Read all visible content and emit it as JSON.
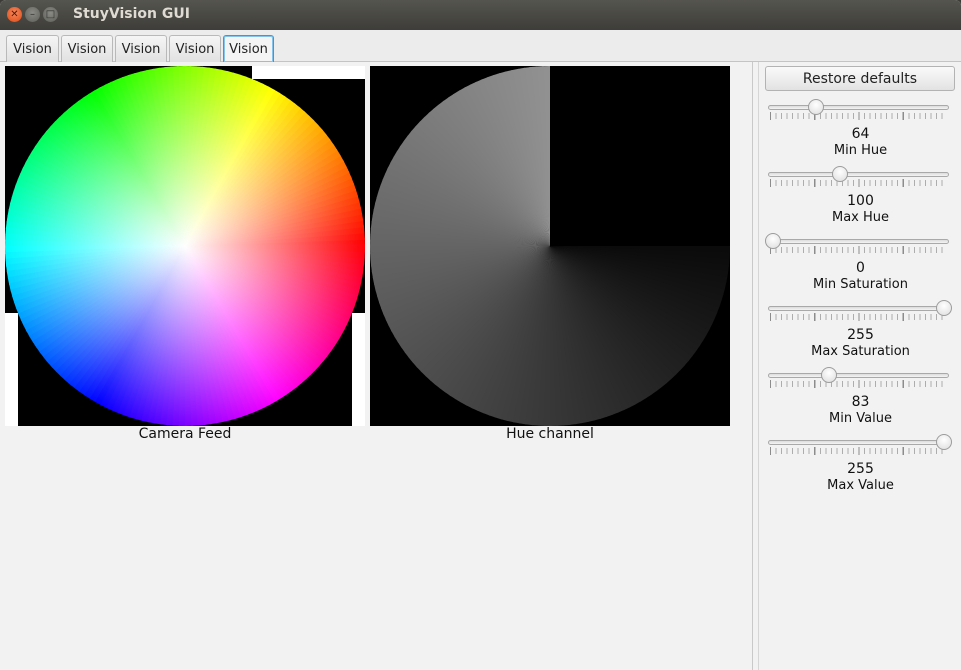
{
  "window": {
    "title": "StuyVision GUI"
  },
  "tabs": [
    {
      "label": "Vision",
      "active": false
    },
    {
      "label": "Vision",
      "active": false
    },
    {
      "label": "Vision",
      "active": false
    },
    {
      "label": "Vision",
      "active": false
    },
    {
      "label": "Vision",
      "active": true
    }
  ],
  "images": {
    "camera_caption": "Camera Feed",
    "hue_caption": "Hue channel"
  },
  "panel": {
    "restore_label": "Restore defaults",
    "sliders": [
      {
        "value": "64",
        "label": "Min Hue",
        "fraction": 0.25
      },
      {
        "value": "100",
        "label": "Max Hue",
        "fraction": 0.39
      },
      {
        "value": "0",
        "label": "Min Saturation",
        "fraction": 0.0
      },
      {
        "value": "255",
        "label": "Max Saturation",
        "fraction": 1.0
      },
      {
        "value": "83",
        "label": "Min Value",
        "fraction": 0.33
      },
      {
        "value": "255",
        "label": "Max Value",
        "fraction": 1.0
      }
    ]
  },
  "icons": {
    "close": "close-icon",
    "minimize": "minimize-icon",
    "maximize": "maximize-icon"
  }
}
